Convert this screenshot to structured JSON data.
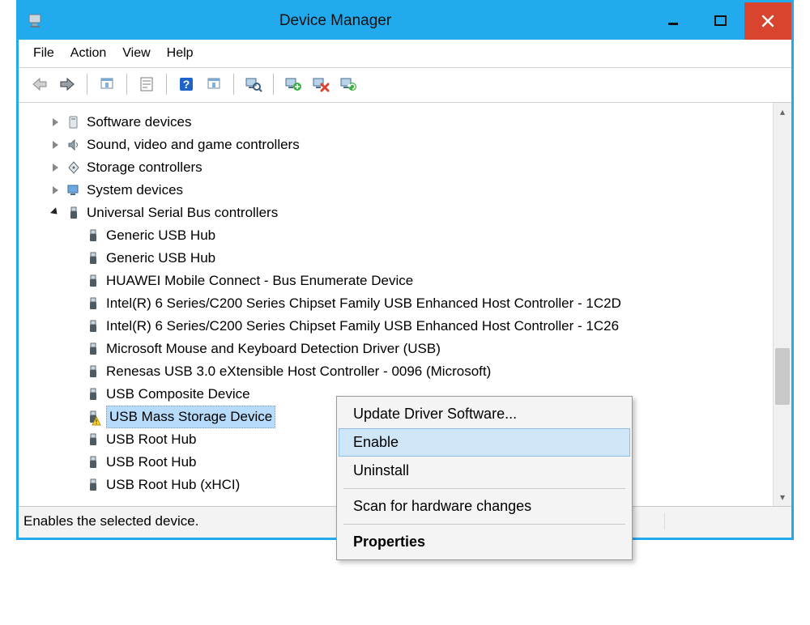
{
  "window": {
    "title": "Device Manager"
  },
  "menubar": {
    "file": "File",
    "action": "Action",
    "view": "View",
    "help": "Help"
  },
  "toolbar": {
    "back": "back-icon",
    "forward": "forward-icon",
    "show_hidden": "show-hidden-icon",
    "properties": "properties-icon",
    "help": "help-icon",
    "refresh": "refresh-icon",
    "scan": "scan-icon",
    "update_driver": "update-driver-icon",
    "disable": "disable-icon",
    "uninstall": "uninstall-icon"
  },
  "tree": {
    "categories": [
      {
        "label": "Software devices",
        "expanded": false,
        "icon": "software-devices-icon"
      },
      {
        "label": "Sound, video and game controllers",
        "expanded": false,
        "icon": "sound-devices-icon"
      },
      {
        "label": "Storage controllers",
        "expanded": false,
        "icon": "storage-controllers-icon"
      },
      {
        "label": "System devices",
        "expanded": false,
        "icon": "system-devices-icon"
      },
      {
        "label": "Universal Serial Bus controllers",
        "expanded": true,
        "icon": "usb-controllers-icon",
        "children": [
          {
            "label": "Generic USB Hub",
            "icon": "usb-device-icon"
          },
          {
            "label": "Generic USB Hub",
            "icon": "usb-device-icon"
          },
          {
            "label": "HUAWEI Mobile Connect - Bus Enumerate Device",
            "icon": "usb-device-icon"
          },
          {
            "label": "Intel(R) 6 Series/C200 Series Chipset Family USB Enhanced Host Controller - 1C2D",
            "icon": "usb-device-icon"
          },
          {
            "label": "Intel(R) 6 Series/C200 Series Chipset Family USB Enhanced Host Controller - 1C26",
            "icon": "usb-device-icon"
          },
          {
            "label": "Microsoft Mouse and Keyboard Detection Driver (USB)",
            "icon": "usb-device-icon"
          },
          {
            "label": "Renesas USB 3.0 eXtensible Host Controller - 0096 (Microsoft)",
            "icon": "usb-device-icon"
          },
          {
            "label": "USB Composite Device",
            "icon": "usb-device-icon"
          },
          {
            "label": "USB Mass Storage Device",
            "icon": "usb-device-warning-icon",
            "selected": true
          },
          {
            "label": "USB Root Hub",
            "icon": "usb-device-icon"
          },
          {
            "label": "USB Root Hub",
            "icon": "usb-device-icon"
          },
          {
            "label": "USB Root Hub (xHCI)",
            "icon": "usb-device-icon"
          }
        ]
      }
    ]
  },
  "context_menu": {
    "update_driver": "Update Driver Software...",
    "enable": "Enable",
    "uninstall": "Uninstall",
    "scan": "Scan for hardware changes",
    "properties": "Properties"
  },
  "statusbar": {
    "text": "Enables the selected device."
  }
}
